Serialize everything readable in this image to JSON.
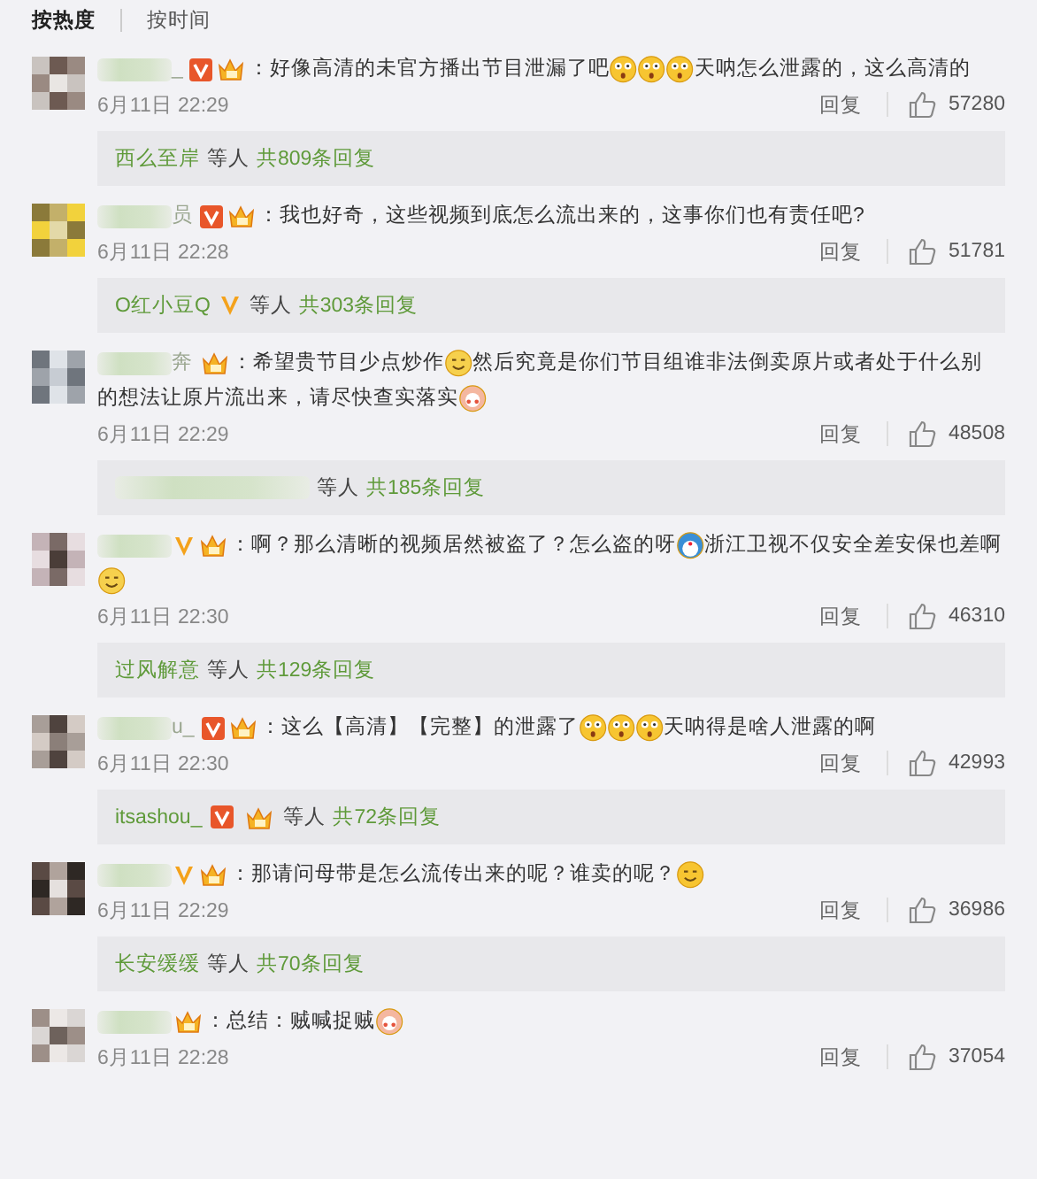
{
  "sort_tabs": [
    {
      "label": "按热度",
      "selected": true
    },
    {
      "label": "按时间",
      "selected": false
    }
  ],
  "comments": [
    {
      "author": {
        "blurred": true,
        "name": "_"
      },
      "badges": [
        {
          "kind": "v-box"
        },
        {
          "kind": "level"
        }
      ],
      "content": [
        {
          "kind": "text",
          "text": "：好像高清的未官方播出节目泄漏了吧"
        },
        {
          "kind": "shocked"
        },
        {
          "kind": "shocked"
        },
        {
          "kind": "shocked"
        },
        {
          "kind": "text",
          "text": "天呐怎么泄露的，这么高清的"
        }
      ],
      "time": "6月11日 22:29",
      "reply_label": "回复",
      "likes": "57280",
      "replies": {
        "names": [
          {
            "blurred": false,
            "name": "西么至岸"
          }
        ],
        "suffix": "等人",
        "count": "共809条回复"
      }
    },
    {
      "author": {
        "blurred": true,
        "name": "员"
      },
      "badges": [
        {
          "kind": "v-box"
        },
        {
          "kind": "level"
        }
      ],
      "content": [
        {
          "kind": "text",
          "text": "：我也好奇，这些视频到底怎么流出来的，这事你们也有责任吧?"
        }
      ],
      "time": "6月11日 22:28",
      "reply_label": "回复",
      "likes": "51781",
      "replies": {
        "names": [
          {
            "blurred": false,
            "name": "O红小豆Q",
            "badges": [
              {
                "kind": "v"
              }
            ]
          }
        ],
        "suffix": "等人",
        "count": "共303条回复"
      }
    },
    {
      "author": {
        "blurred": true,
        "name": "奔"
      },
      "badges": [
        {
          "kind": "level"
        }
      ],
      "content": [
        {
          "kind": "text",
          "text": "：希望贵节目少点炒作"
        },
        {
          "kind": "smile"
        },
        {
          "kind": "text",
          "text": "然后究竟是你们节目组谁非法倒卖原片或者处于什么别"
        },
        {
          "kind": "text",
          "text": "的想法让原片流出来，请尽快查实落实"
        },
        {
          "kind": "blush"
        }
      ],
      "time": "6月11日 22:29",
      "reply_label": "回复",
      "likes": "48508",
      "replies": {
        "names": [
          {
            "blurred": true
          }
        ],
        "suffix": "等人",
        "count": "共185条回复"
      }
    },
    {
      "author": {
        "blurred": true
      },
      "badges": [
        {
          "kind": "v"
        },
        {
          "kind": "level"
        }
      ],
      "content": [
        {
          "kind": "text",
          "text": "：啊？那么清晰的视频居然被盗了？怎么盗的呀"
        },
        {
          "kind": "blue"
        },
        {
          "kind": "text",
          "text": "浙江卫视不仅安全差安保也"
        },
        {
          "kind": "text",
          "text": "差啊"
        },
        {
          "kind": "smile"
        }
      ],
      "time": "6月11日 22:30",
      "reply_label": "回复",
      "likes": "46310",
      "replies": {
        "names": [
          {
            "blurred": false,
            "name": "过风解意"
          }
        ],
        "suffix": "等人",
        "count": "共129条回复"
      }
    },
    {
      "author": {
        "blurred": true,
        "name": "u_"
      },
      "badges": [
        {
          "kind": "v-box"
        },
        {
          "kind": "level"
        }
      ],
      "content": [
        {
          "kind": "text",
          "text": "：这么【高清】【完整】的泄露了"
        },
        {
          "kind": "shocked"
        },
        {
          "kind": "shocked"
        },
        {
          "kind": "shocked"
        },
        {
          "kind": "text",
          "text": "天呐得是啥人泄露的啊"
        }
      ],
      "time": "6月11日 22:30",
      "reply_label": "回复",
      "likes": "42993",
      "replies": {
        "names": [
          {
            "blurred": false,
            "name": "itsashou_",
            "badges": [
              {
                "kind": "v-box"
              },
              {
                "kind": "level"
              }
            ]
          }
        ],
        "suffix": "等人",
        "count": "共72条回复"
      }
    },
    {
      "author": {
        "blurred": true
      },
      "badges": [
        {
          "kind": "v"
        },
        {
          "kind": "level"
        }
      ],
      "content": [
        {
          "kind": "text",
          "text": "：那请问母带是怎么流传出来的呢？谁卖的呢？"
        },
        {
          "kind": "grin"
        }
      ],
      "time": "6月11日 22:29",
      "reply_label": "回复",
      "likes": "36986",
      "replies": {
        "names": [
          {
            "blurred": false,
            "name": "长安缓缓"
          }
        ],
        "suffix": "等人",
        "count": "共70条回复"
      }
    },
    {
      "author": {
        "blurred": true
      },
      "badges": [
        {
          "kind": "level"
        }
      ],
      "content": [
        {
          "kind": "text",
          "text": "：总结：贼喊捉贼"
        },
        {
          "kind": "blush"
        }
      ],
      "time": "6月11日 22:28",
      "reply_label": "回复",
      "likes": "37054"
    }
  ]
}
